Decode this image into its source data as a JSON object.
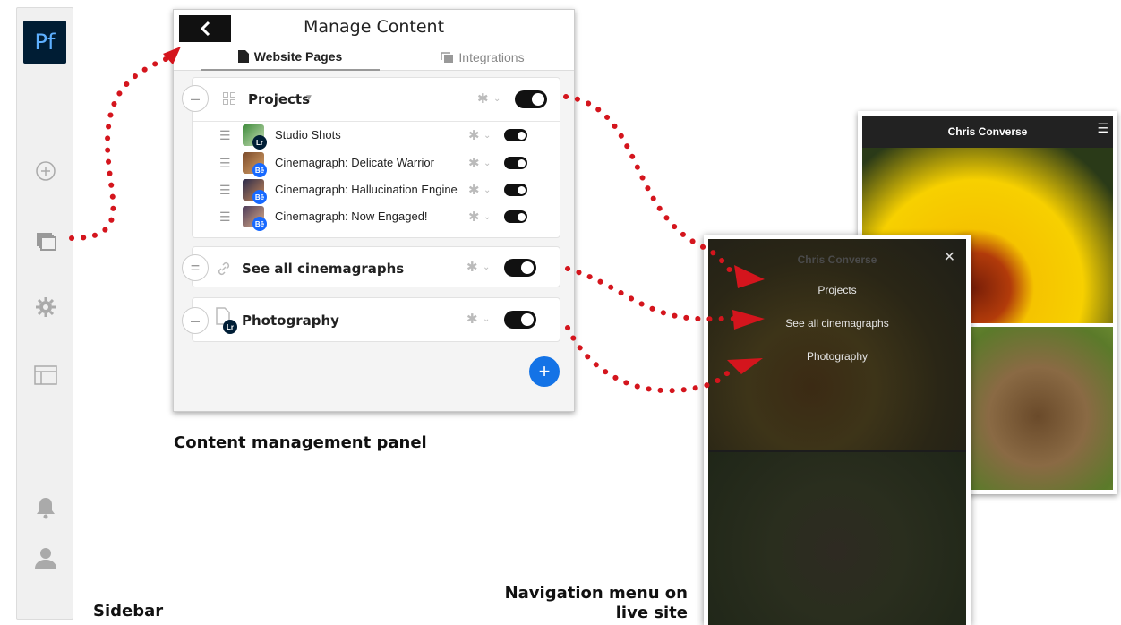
{
  "sidebar": {
    "logo": "Pf",
    "icons": [
      "add-circle-icon",
      "pages-icon",
      "gear-icon",
      "layout-icon",
      "bell-icon",
      "user-icon"
    ],
    "caption": "Sidebar"
  },
  "panel": {
    "title": "Manage Content",
    "caption": "Content management panel",
    "tabs": [
      {
        "label": "Website Pages",
        "active": true
      },
      {
        "label": "Integrations",
        "active": false
      }
    ],
    "sections": [
      {
        "title": "Projects",
        "items": [
          {
            "label": "Studio Shots",
            "badge": "Lr"
          },
          {
            "label": "Cinemagraph: Delicate Warrior",
            "badge": "Bē"
          },
          {
            "label": "Cinemagraph: Hallucination Engine",
            "badge": "Bē"
          },
          {
            "label": "Cinemagraph: Now Engaged!",
            "badge": "Bē"
          }
        ]
      },
      {
        "title": "See all cinemagraphs"
      },
      {
        "title": "Photography",
        "badge": "Lr"
      }
    ]
  },
  "live_site": {
    "caption": "Navigation menu on live site",
    "header_title": "Chris Converse",
    "menu_items": [
      "Projects",
      "See all cinemagraphs",
      "Photography"
    ]
  },
  "colors": {
    "accent_blue": "#1473e6",
    "pf_dark": "#001d34",
    "arrow_red": "#d4151d",
    "behance_blue": "#1769ff",
    "lightroom_dark": "#001e36"
  }
}
